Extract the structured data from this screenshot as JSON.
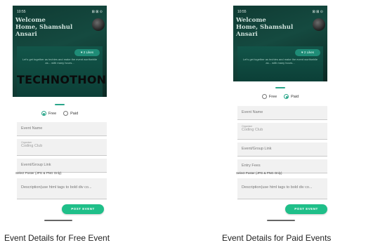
{
  "free": {
    "status_time": "10:55",
    "status_icons": "⊠ ⊠ ⊙",
    "welcome": "Welcome\nHome, Shamshul Ansari",
    "likes": "♥ 2 Likes",
    "caption": "Let's get together as techies and make the event worthwhile as... with many hours...",
    "poster_text": "TECHNOTHON",
    "radio_free": "Free",
    "radio_paid": "Paid",
    "fields": [
      {
        "label": "Event Name"
      },
      {
        "label": "Organiser",
        "value": "Coding Club"
      },
      {
        "label": "Event/Group Link"
      }
    ],
    "select_poster": "Select Poster (JPG & PNG Only)",
    "description": "Description(use html tags to bold div co...",
    "button": "POST EVENT",
    "caption_below": "Event Details for Free Event"
  },
  "paid": {
    "status_time": "10:55",
    "status_icons": "⊠ ⊠ ⊙",
    "welcome": "Welcome\nHome, Shamshul Ansari",
    "likes": "♥ 2 Likes",
    "caption": "Let's get together as techies and make the event worthwhile as... with many hours...",
    "radio_free": "Free",
    "radio_paid": "Paid",
    "fields": [
      {
        "label": "Event Name"
      },
      {
        "label": "Organiser",
        "value": "Coding Club"
      },
      {
        "label": "Event/Group Link"
      },
      {
        "label": "Entry Fees"
      }
    ],
    "select_poster": "Select Poster (JPG & PNG Only)",
    "description": "Description(use html tags to bold div co...",
    "button": "POST EVENT",
    "caption_below": "Event Details for Paid Events"
  },
  "colors": {
    "accent": "#1fbf89",
    "hero_dark": "#0f3b33"
  }
}
